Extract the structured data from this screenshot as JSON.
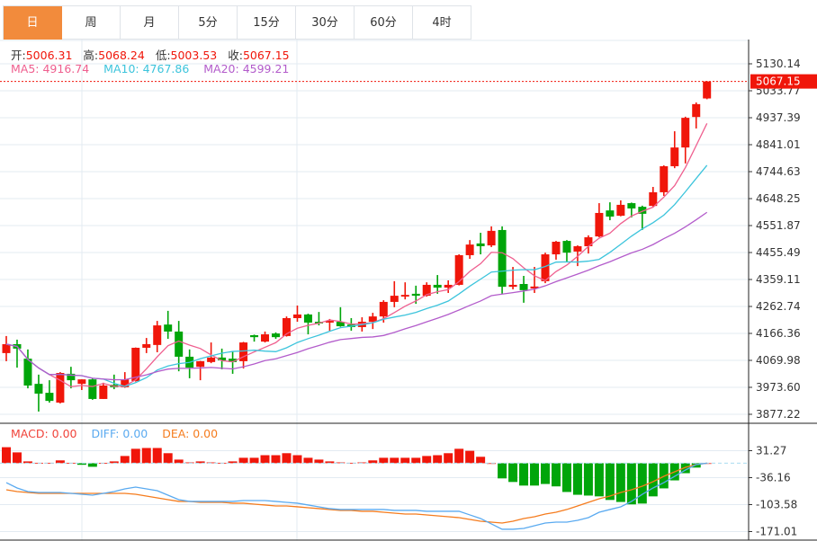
{
  "tabs": [
    {
      "label": "日",
      "active": true
    },
    {
      "label": "周",
      "active": false
    },
    {
      "label": "月",
      "active": false
    },
    {
      "label": "5分",
      "active": false
    },
    {
      "label": "15分",
      "active": false
    },
    {
      "label": "30分",
      "active": false
    },
    {
      "label": "60分",
      "active": false
    },
    {
      "label": "4时",
      "active": false
    }
  ],
  "ohlc_legend": {
    "open_label": "开:",
    "open": "5006.31",
    "high_label": "高:",
    "high": "5068.24",
    "low_label": "低:",
    "low": "5003.53",
    "close_label": "收:",
    "close": "5067.15"
  },
  "ma_legend": {
    "ma5": "MA5: 4916.74",
    "ma10": "MA10: 4767.86",
    "ma20": "MA20: 4599.21"
  },
  "macd_legend": {
    "macd": "MACD: 0.00",
    "diff": "DIFF: 0.00",
    "dea": "DEA: 0.00"
  },
  "colors": {
    "up": "#f0160a",
    "down": "#00a50a",
    "ma5": "#ef5f8f",
    "ma10": "#3cc4dc",
    "ma20": "#b35ccb",
    "diff": "#5aaaf0",
    "dea": "#f57c1e",
    "tab_active": "#f28b3c"
  },
  "chart_data": {
    "type": "candlestick",
    "price_axis_ticks": [
      "5130.14",
      "5033.77",
      "4937.39",
      "4841.01",
      "4744.63",
      "4648.25",
      "4551.87",
      "4455.49",
      "4359.11",
      "4262.74",
      "4166.36",
      "4069.98",
      "3973.60",
      "3877.22"
    ],
    "last_price_label": "5067.15",
    "ylim": [
      3877.22,
      5130.14
    ],
    "candles_ohlc": [
      [
        4096,
        4157,
        4067,
        4128
      ],
      [
        4128,
        4144,
        4044,
        4112
      ],
      [
        4076,
        4109,
        3970,
        3980
      ],
      [
        3986,
        4019,
        3887,
        3951
      ],
      [
        3954,
        3999,
        3919,
        3925
      ],
      [
        3919,
        4028,
        3916,
        4025
      ],
      [
        4022,
        4047,
        3970,
        3999
      ],
      [
        3986,
        4002,
        3964,
        4002
      ],
      [
        4002,
        4005,
        3929,
        3932
      ],
      [
        3932,
        3990,
        3932,
        3980
      ],
      [
        3983,
        4019,
        3967,
        3974
      ],
      [
        3974,
        4028,
        3972,
        4002
      ],
      [
        3996,
        4116,
        3994,
        4115
      ],
      [
        4115,
        4150,
        4096,
        4128
      ],
      [
        4125,
        4211,
        4099,
        4195
      ],
      [
        4198,
        4247,
        4147,
        4173
      ],
      [
        4173,
        4211,
        4031,
        4083
      ],
      [
        4083,
        4109,
        4006,
        4044
      ],
      [
        4047,
        4068,
        3999,
        4067
      ],
      [
        4064,
        4134,
        4060,
        4080
      ],
      [
        4080,
        4112,
        4038,
        4070
      ],
      [
        4076,
        4102,
        4022,
        4064
      ],
      [
        4067,
        4136,
        4041,
        4134
      ],
      [
        4160,
        4162,
        4137,
        4153
      ],
      [
        4137,
        4173,
        4134,
        4163
      ],
      [
        4166,
        4170,
        4147,
        4153
      ],
      [
        4157,
        4227,
        4155,
        4221
      ],
      [
        4221,
        4266,
        4208,
        4234
      ],
      [
        4234,
        4237,
        4163,
        4205
      ],
      [
        4208,
        4243,
        4195,
        4202
      ],
      [
        4205,
        4218,
        4176,
        4211
      ],
      [
        4208,
        4260,
        4190,
        4192
      ],
      [
        4198,
        4221,
        4176,
        4189
      ],
      [
        4189,
        4224,
        4173,
        4208
      ],
      [
        4208,
        4240,
        4182,
        4227
      ],
      [
        4227,
        4285,
        4205,
        4279
      ],
      [
        4279,
        4353,
        4260,
        4301
      ],
      [
        4298,
        4349,
        4288,
        4304
      ],
      [
        4308,
        4337,
        4272,
        4301
      ],
      [
        4301,
        4349,
        4298,
        4340
      ],
      [
        4340,
        4375,
        4308,
        4330
      ],
      [
        4330,
        4356,
        4311,
        4340
      ],
      [
        4340,
        4449,
        4338,
        4446
      ],
      [
        4446,
        4500,
        4433,
        4484
      ],
      [
        4488,
        4526,
        4449,
        4478
      ],
      [
        4481,
        4549,
        4475,
        4533
      ],
      [
        4536,
        4549,
        4308,
        4333
      ],
      [
        4333,
        4404,
        4324,
        4340
      ],
      [
        4343,
        4372,
        4276,
        4321
      ],
      [
        4327,
        4404,
        4311,
        4334
      ],
      [
        4353,
        4455,
        4346,
        4449
      ],
      [
        4449,
        4497,
        4430,
        4494
      ],
      [
        4497,
        4500,
        4423,
        4455
      ],
      [
        4459,
        4481,
        4407,
        4478
      ],
      [
        4478,
        4517,
        4452,
        4510
      ],
      [
        4513,
        4632,
        4510,
        4597
      ],
      [
        4606,
        4635,
        4571,
        4584
      ],
      [
        4587,
        4642,
        4585,
        4626
      ],
      [
        4632,
        4634,
        4581,
        4613
      ],
      [
        4619,
        4623,
        4536,
        4594
      ],
      [
        4622,
        4690,
        4620,
        4671
      ],
      [
        4671,
        4767,
        4658,
        4764
      ],
      [
        4764,
        4889,
        4757,
        4831
      ],
      [
        4831,
        4941,
        4774,
        4937
      ],
      [
        4940,
        4992,
        4899,
        4986
      ],
      [
        5006.31,
        5068.24,
        5003.53,
        5067.15
      ]
    ],
    "macd_axis_ticks": [
      "31.27",
      "-36.16",
      "-103.58",
      "-171.01"
    ],
    "macd_ylim": [
      -171.01,
      31.27
    ],
    "macd": [
      40,
      27,
      4.5,
      1,
      1,
      7,
      1,
      -4,
      -9,
      0.5,
      4.5,
      18,
      36,
      38,
      38,
      25,
      9,
      2,
      4.5,
      2,
      1,
      4.5,
      13.5,
      13.5,
      20,
      20,
      25,
      20,
      13.5,
      9,
      4.5,
      2,
      1,
      2,
      7,
      13.5,
      13.5,
      13.5,
      13.5,
      18,
      20,
      25,
      36,
      31,
      16,
      0,
      -38,
      -47,
      -56,
      -56,
      -52,
      -58,
      -72,
      -79,
      -81,
      -83,
      -92,
      -97,
      -103,
      -101,
      -83,
      -63,
      -43,
      -25,
      -11,
      0
    ],
    "diff": [
      -48.6,
      -62,
      -71,
      -73.3,
      -73.3,
      -73.3,
      -75.5,
      -77.8,
      -80,
      -75.5,
      -71,
      -64.3,
      -59.8,
      -64.3,
      -68.8,
      -80,
      -91.2,
      -95.6,
      -95.6,
      -95.6,
      -95.6,
      -95.6,
      -93.4,
      -93.4,
      -93.4,
      -95.6,
      -97.9,
      -100.1,
      -104.6,
      -109.1,
      -113.6,
      -115.8,
      -115.8,
      -115.8,
      -115.8,
      -115.8,
      -118.1,
      -118.1,
      -118.1,
      -120.3,
      -120.3,
      -120.3,
      -120.3,
      -129.3,
      -138.3,
      -151.8,
      -165.3,
      -165.3,
      -163.1,
      -156.4,
      -149.7,
      -147.4,
      -147.4,
      -142.9,
      -136.2,
      -122.7,
      -115.8,
      -109.1,
      -95.6,
      -77.8,
      -62,
      -48.6,
      -32.8,
      -17.1,
      -3.6,
      0
    ],
    "dea": [
      -66.5,
      -71,
      -73.3,
      -75.5,
      -75.5,
      -75.5,
      -75.5,
      -75.5,
      -75.5,
      -75.5,
      -75.5,
      -75.5,
      -77.8,
      -82.3,
      -86.8,
      -91.2,
      -95.6,
      -95.6,
      -97.9,
      -97.9,
      -97.9,
      -100.1,
      -100.1,
      -102.4,
      -104.6,
      -106.9,
      -106.9,
      -109.1,
      -111.4,
      -113.6,
      -115.8,
      -118.1,
      -118.1,
      -120.3,
      -120.3,
      -122.7,
      -125,
      -127.2,
      -127.2,
      -129.5,
      -131.7,
      -134,
      -136.2,
      -140.7,
      -145.2,
      -147.4,
      -149.7,
      -145.2,
      -138.4,
      -134,
      -127.2,
      -122.7,
      -115.8,
      -106.9,
      -97.9,
      -89,
      -82.3,
      -73.3,
      -66.5,
      -57.5,
      -46.3,
      -32.8,
      -21.6,
      -10.3,
      -3.6,
      0
    ]
  }
}
